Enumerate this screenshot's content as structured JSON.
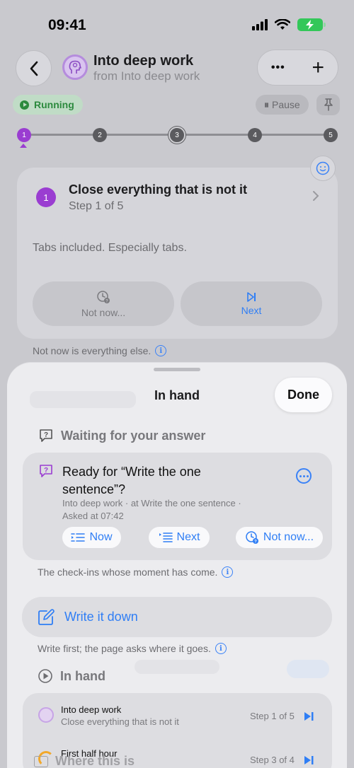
{
  "status_bar": {
    "time": "09:41"
  },
  "header": {
    "title": "Into deep work",
    "subtitle": "from Into deep work",
    "more_label": "•••",
    "add_label": "+"
  },
  "controls": {
    "running_label": "Running",
    "pause_label": "Pause"
  },
  "progress": {
    "steps": [
      "1",
      "2",
      "3",
      "4",
      "5"
    ],
    "current": 1
  },
  "step_card": {
    "number": "1",
    "title": "Close everything that is not it",
    "subtitle": "Step 1 of 5",
    "body": "Tabs included. Especially tabs.",
    "not_now_label": "Not now...",
    "next_label": "Next"
  },
  "not_now_note": "Not now is everything else.",
  "sheet": {
    "title": "In hand",
    "done_label": "Done",
    "waiting_header": "Waiting for your answer",
    "question": {
      "title": "Ready for “Write the one sentence”?",
      "meta_line1": "Into deep work · at Write the one sentence ·",
      "meta_line2": "Asked at 07:42",
      "now_label": "Now",
      "next_label": "Next",
      "not_now_label": "Not now..."
    },
    "checkin_note": "The check-ins whose moment has come.",
    "write_label": "Write it down",
    "write_note": "Write first; the page asks where it goes.",
    "in_hand_header": "In hand",
    "items": [
      {
        "title": "Into deep work",
        "subtitle": "Close everything that is not it",
        "step": "Step 1 of 5"
      },
      {
        "title": "First half hour",
        "subtitle": "",
        "step": "Step 3 of 4"
      }
    ],
    "behind_text": "Where this is"
  },
  "colors": {
    "accent_purple": "#9a3dd1",
    "link_blue": "#2f7ef5",
    "running_green": "#2c8a3e"
  }
}
